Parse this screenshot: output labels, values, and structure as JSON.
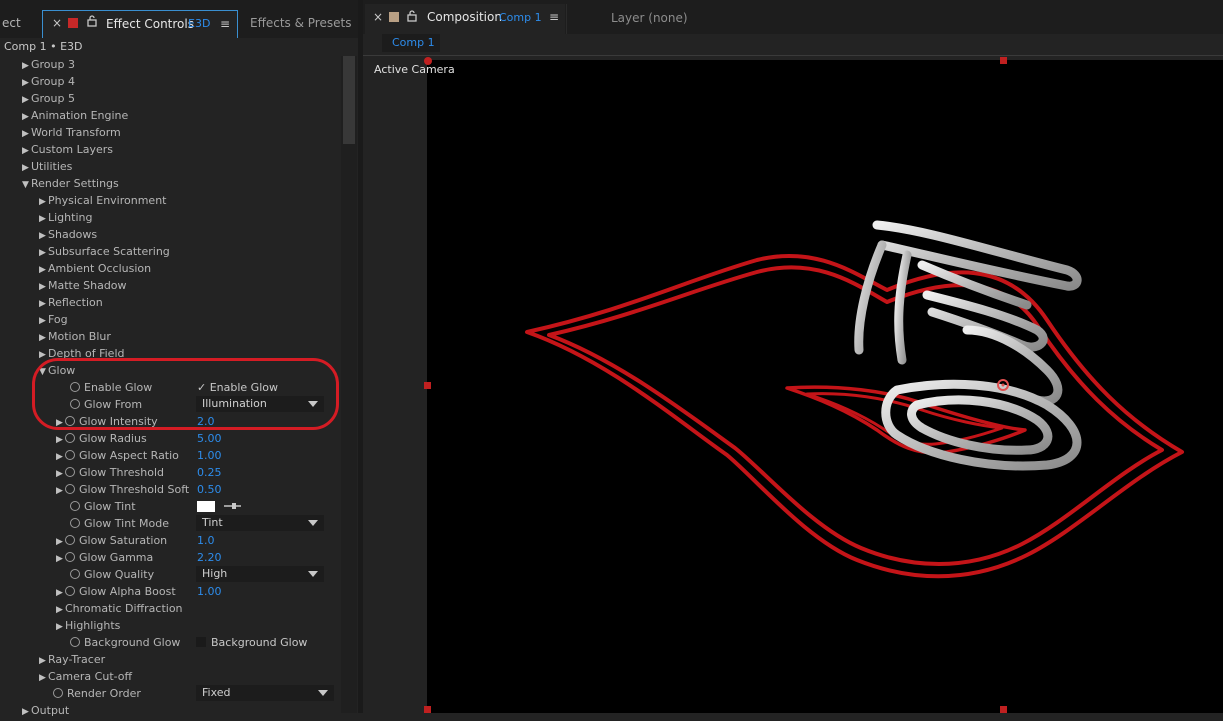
{
  "left_panel": {
    "tabs": {
      "partial_tab": "ect",
      "close_glyph": "×",
      "lock_glyph": "🔓",
      "effect_controls": "Effect Controls",
      "effect_controls_suffix": "E3D",
      "menu_glyph": "≡",
      "effects_presets": "Effects & Presets"
    },
    "breadcrumb": "Comp 1 • E3D",
    "tree": [
      {
        "label": "Group 3",
        "state": "collapsed"
      },
      {
        "label": "Group 4",
        "state": "collapsed"
      },
      {
        "label": "Group 5",
        "state": "collapsed"
      },
      {
        "label": "Animation Engine",
        "state": "collapsed"
      },
      {
        "label": "World Transform",
        "state": "collapsed"
      },
      {
        "label": "Custom Layers",
        "state": "collapsed"
      },
      {
        "label": "Utilities",
        "state": "collapsed"
      },
      {
        "label": "Render Settings",
        "state": "expanded"
      },
      {
        "label": "Physical Environment",
        "state": "collapsed"
      },
      {
        "label": "Lighting",
        "state": "collapsed"
      },
      {
        "label": "Shadows",
        "state": "collapsed"
      },
      {
        "label": "Subsurface Scattering",
        "state": "collapsed"
      },
      {
        "label": "Ambient Occlusion",
        "state": "collapsed"
      },
      {
        "label": "Matte Shadow",
        "state": "collapsed"
      },
      {
        "label": "Reflection",
        "state": "collapsed"
      },
      {
        "label": "Fog",
        "state": "collapsed"
      },
      {
        "label": "Motion Blur",
        "state": "collapsed"
      },
      {
        "label": "Depth of Field",
        "state": "collapsed"
      },
      {
        "label": "Glow",
        "state": "expanded"
      }
    ],
    "glow_props": [
      {
        "label": "Enable Glow",
        "value": "Enable Glow",
        "kind": "checkbox",
        "checked": true
      },
      {
        "label": "Glow From",
        "value": "Illumination",
        "kind": "dropdown"
      },
      {
        "label": "Glow Intensity",
        "value": "2.0",
        "kind": "number"
      },
      {
        "label": "Glow Radius",
        "value": "5.00",
        "kind": "number"
      },
      {
        "label": "Glow Aspect Ratio",
        "value": "1.00",
        "kind": "number"
      },
      {
        "label": "Glow Threshold",
        "value": "0.25",
        "kind": "number"
      },
      {
        "label": "Glow Threshold Soft",
        "value": "0.50",
        "kind": "number"
      },
      {
        "label": "Glow Tint",
        "value": "",
        "kind": "color",
        "color": "#ffffff"
      },
      {
        "label": "Glow Tint Mode",
        "value": "Tint",
        "kind": "dropdown"
      },
      {
        "label": "Glow Saturation",
        "value": "1.0",
        "kind": "number"
      },
      {
        "label": "Glow Gamma",
        "value": "2.20",
        "kind": "number"
      },
      {
        "label": "Glow Quality",
        "value": "High",
        "kind": "dropdown"
      },
      {
        "label": "Glow Alpha Boost",
        "value": "1.00",
        "kind": "number"
      }
    ],
    "glow_subgroups": [
      "Chromatic Diffraction",
      "Highlights"
    ],
    "background_glow": {
      "label": "Background Glow",
      "value": "Background Glow",
      "checked": false
    },
    "after_glow": [
      {
        "label": "Ray-Tracer",
        "state": "collapsed"
      },
      {
        "label": "Camera Cut-off",
        "state": "collapsed"
      }
    ],
    "render_order": {
      "label": "Render Order",
      "value": "Fixed"
    },
    "output": {
      "label": "Output",
      "state": "collapsed"
    }
  },
  "right_panel": {
    "tabs": {
      "close_glyph": "×",
      "lock_glyph": "🔓",
      "composition": "Composition",
      "composition_suffix": "Comp 1",
      "menu_glyph": "≡",
      "layer": "Layer  (none)"
    },
    "subtab": "Comp 1",
    "camera_label": "Active Camera"
  },
  "colors": {
    "accent_blue": "#2d8ceb",
    "annotation_red": "#d41c24",
    "outline_red": "#c41418",
    "logo_silver": "#c8c8c8"
  }
}
